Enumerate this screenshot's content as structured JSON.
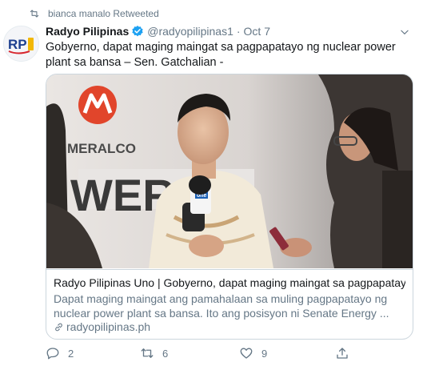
{
  "retweet": {
    "text": "bianca manalo Retweeted",
    "icon": "retweet-icon"
  },
  "author": {
    "name": "Radyo Pilipinas",
    "handle": "@radyopilipinas1",
    "separator": "·",
    "date": "Oct 7",
    "avatar_text": "RP1",
    "verified": true
  },
  "tweet": {
    "text": "Gobyerno, dapat maging maingat sa pagpapatayo ng nuclear power plant sa bansa – Sen. Gatchalian -"
  },
  "card": {
    "photo": {
      "logo_text": "MERALCO",
      "banner_text": "WER UP",
      "mic_text": "one"
    },
    "title": "Radyo Pilipinas Uno | Gobyerno, dapat maging maingat sa pagpapatay...",
    "description": "Dapat maging maingat ang pamahalaan sa muling pagpapatayo ng nuclear power plant sa bansa. Ito ang posisyon ni Senate Energy ...",
    "domain": "radyopilipinas.ph"
  },
  "actions": {
    "reply_count": "2",
    "retweet_count": "6",
    "like_count": "9"
  },
  "colors": {
    "accent": "#1da1f2",
    "secondary_text": "#657786",
    "border": "#ccd6dd"
  }
}
